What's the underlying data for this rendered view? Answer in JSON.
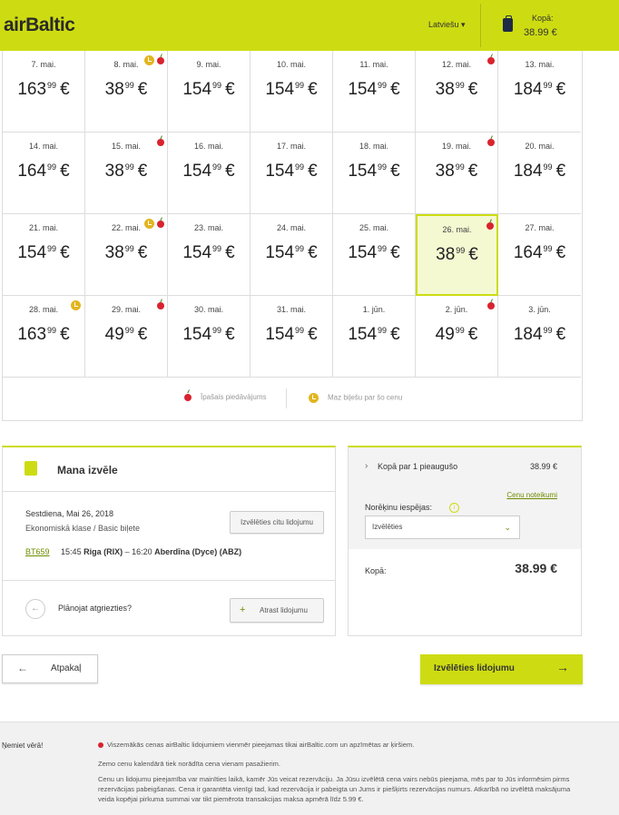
{
  "header": {
    "logo": "airBaltic",
    "language": "Latviešu ▾",
    "cart_label": "Kopā:",
    "cart_amount": "38.99 €"
  },
  "calendar": {
    "currency": "€",
    "rows": [
      [
        {
          "date": "7. mai.",
          "whole": "163",
          "cents": "99",
          "cherry": false,
          "clock": false,
          "selected": false
        },
        {
          "date": "8. mai.",
          "whole": "38",
          "cents": "99",
          "cherry": true,
          "clock": true,
          "selected": false
        },
        {
          "date": "9. mai.",
          "whole": "154",
          "cents": "99",
          "cherry": false,
          "clock": false,
          "selected": false
        },
        {
          "date": "10. mai.",
          "whole": "154",
          "cents": "99",
          "cherry": false,
          "clock": false,
          "selected": false
        },
        {
          "date": "11. mai.",
          "whole": "154",
          "cents": "99",
          "cherry": false,
          "clock": false,
          "selected": false
        },
        {
          "date": "12. mai.",
          "whole": "38",
          "cents": "99",
          "cherry": true,
          "clock": false,
          "selected": false
        },
        {
          "date": "13. mai.",
          "whole": "184",
          "cents": "99",
          "cherry": false,
          "clock": false,
          "selected": false
        }
      ],
      [
        {
          "date": "14. mai.",
          "whole": "164",
          "cents": "99",
          "cherry": false,
          "clock": false,
          "selected": false
        },
        {
          "date": "15. mai.",
          "whole": "38",
          "cents": "99",
          "cherry": true,
          "clock": false,
          "selected": false
        },
        {
          "date": "16. mai.",
          "whole": "154",
          "cents": "99",
          "cherry": false,
          "clock": false,
          "selected": false
        },
        {
          "date": "17. mai.",
          "whole": "154",
          "cents": "99",
          "cherry": false,
          "clock": false,
          "selected": false
        },
        {
          "date": "18. mai.",
          "whole": "154",
          "cents": "99",
          "cherry": false,
          "clock": false,
          "selected": false
        },
        {
          "date": "19. mai.",
          "whole": "38",
          "cents": "99",
          "cherry": true,
          "clock": false,
          "selected": false
        },
        {
          "date": "20. mai.",
          "whole": "184",
          "cents": "99",
          "cherry": false,
          "clock": false,
          "selected": false
        }
      ],
      [
        {
          "date": "21. mai.",
          "whole": "154",
          "cents": "99",
          "cherry": false,
          "clock": false,
          "selected": false
        },
        {
          "date": "22. mai.",
          "whole": "38",
          "cents": "99",
          "cherry": true,
          "clock": true,
          "selected": false
        },
        {
          "date": "23. mai.",
          "whole": "154",
          "cents": "99",
          "cherry": false,
          "clock": false,
          "selected": false
        },
        {
          "date": "24. mai.",
          "whole": "154",
          "cents": "99",
          "cherry": false,
          "clock": false,
          "selected": false
        },
        {
          "date": "25. mai.",
          "whole": "154",
          "cents": "99",
          "cherry": false,
          "clock": false,
          "selected": false
        },
        {
          "date": "26. mai.",
          "whole": "38",
          "cents": "99",
          "cherry": true,
          "clock": false,
          "selected": true
        },
        {
          "date": "27. mai.",
          "whole": "164",
          "cents": "99",
          "cherry": false,
          "clock": false,
          "selected": false
        }
      ],
      [
        {
          "date": "28. mai.",
          "whole": "163",
          "cents": "99",
          "cherry": false,
          "clock": true,
          "selected": false
        },
        {
          "date": "29. mai.",
          "whole": "49",
          "cents": "99",
          "cherry": true,
          "clock": false,
          "selected": false
        },
        {
          "date": "30. mai.",
          "whole": "154",
          "cents": "99",
          "cherry": false,
          "clock": false,
          "selected": false
        },
        {
          "date": "31. mai.",
          "whole": "154",
          "cents": "99",
          "cherry": false,
          "clock": false,
          "selected": false
        },
        {
          "date": "1. jūn.",
          "whole": "154",
          "cents": "99",
          "cherry": false,
          "clock": false,
          "selected": false
        },
        {
          "date": "2. jūn.",
          "whole": "49",
          "cents": "99",
          "cherry": true,
          "clock": false,
          "selected": false
        },
        {
          "date": "3. jūn.",
          "whole": "184",
          "cents": "99",
          "cherry": false,
          "clock": false,
          "selected": false
        }
      ]
    ],
    "legend_special": "Īpašais piedāvājums",
    "legend_few": "Maz biļešu par šo cenu"
  },
  "selection": {
    "title": "Mana izvēle",
    "date": "Sestdiena, Mai 26, 2018",
    "class": "Ekonomiskā klase / Basic biļete",
    "choose_other": "Izvēlēties citu lidojumu",
    "flight_no": "BT659",
    "dep_time": "15:45",
    "dep_city": "Riga (RIX)",
    "arr_time": "– 16:20",
    "arr_city": "Aberdīna (Dyce) (ABZ)",
    "plan_return": "Plānojat atgriezties?",
    "find_flight": "Atrast lidojumu"
  },
  "summary": {
    "adult_label": "Kopā par 1 pieaugušo",
    "adult_amount": "38.99 €",
    "terms": "Cenu noteikumi",
    "payment_label": "Norēķinu iespējas:",
    "payment_value": "Izvēlēties",
    "total_label": "Kopā:",
    "total_amount": "38.99 €"
  },
  "buttons": {
    "back": "Atpakaļ",
    "choose": "Izvēlēties lidojumu"
  },
  "footer": {
    "title": "Ņemiet vērā!",
    "p1": "Viszemākās cenas airBaltic lidojumiem vienmēr pieejamas tikai airBaltic.com un apzīmētas ar ķiršiem.",
    "p2": "Zemo cenu kalendārā tiek norādīta cena vienam pasažierim.",
    "p3": "Cenu un lidojumu pieejamība var mainīties laikā, kamēr Jūs veicat rezervāciju. Ja Jūsu izvēlētā cena vairs nebūs pieejama, mēs par to Jūs informēsim pirms rezervācijas pabeigšanas. Cena ir garantēta vienīgi tad, kad rezervācija ir pabeigta un Jums ir piešķirts rezervācijas numurs. Atkarībā no izvēlētā maksājuma veida kopējai pirkuma summai var tikt piemērota transakcijas maksa apmērā līdz 5.99 €."
  }
}
